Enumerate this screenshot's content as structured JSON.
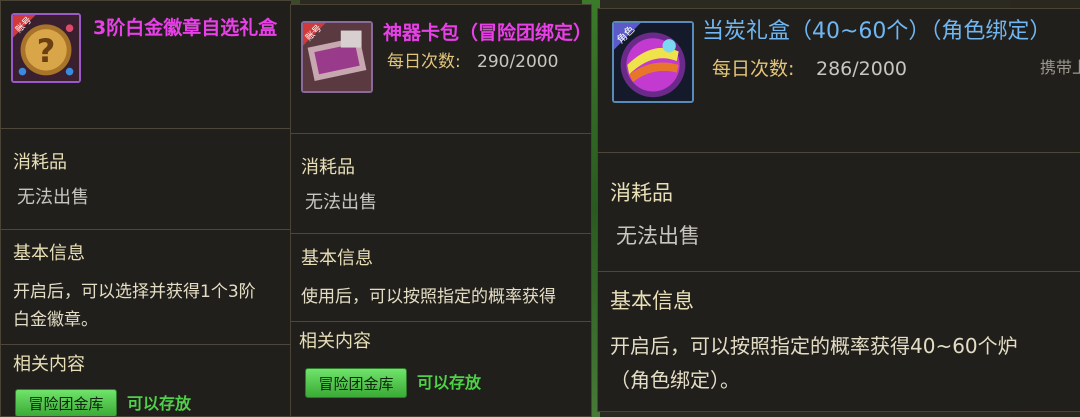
{
  "colors": {
    "title_magenta": "#e83fe8",
    "title_blue": "#6fb6f2",
    "label_yellow": "#e3c579",
    "tag_green": "#4ed148"
  },
  "panels": [
    {
      "icon": "gold-badge-box-icon",
      "badge_text": "账号",
      "title": "3阶白金徽章自选礼盒",
      "type": "消耗品",
      "trade": "无法出售",
      "basic_info_heading": "基本信息",
      "description_line1": "开启后，可以选择并获得1个3阶",
      "description_line2": "白金徽章。",
      "related_heading": "相关内容",
      "storage_tag": "冒险团金库",
      "storage_status": "可以存放"
    },
    {
      "icon": "artifact-card-pack-icon",
      "badge_text": "账号",
      "title": "神器卡包（冒险团绑定）",
      "daily_label": "每日次数:",
      "daily_value": "290/2000",
      "type": "消耗品",
      "trade": "无法出售",
      "basic_info_heading": "基本信息",
      "description_line1": "使用后，可以按照指定的概率获得",
      "related_heading": "相关内容",
      "storage_tag": "冒险团金库",
      "storage_status": "可以存放"
    },
    {
      "icon": "character-gift-orb-icon",
      "badge_text": "角色",
      "title": "当炭礼盒（40~60个）（角色绑定）",
      "daily_label": "每日次数:",
      "daily_value": "286/2000",
      "carry_label": "携带上",
      "type": "消耗品",
      "trade": "无法出售",
      "basic_info_heading": "基本信息",
      "description_line1": "开启后，可以按照指定的概率获得40~60个炉",
      "description_line2": "（角色绑定）。"
    }
  ]
}
